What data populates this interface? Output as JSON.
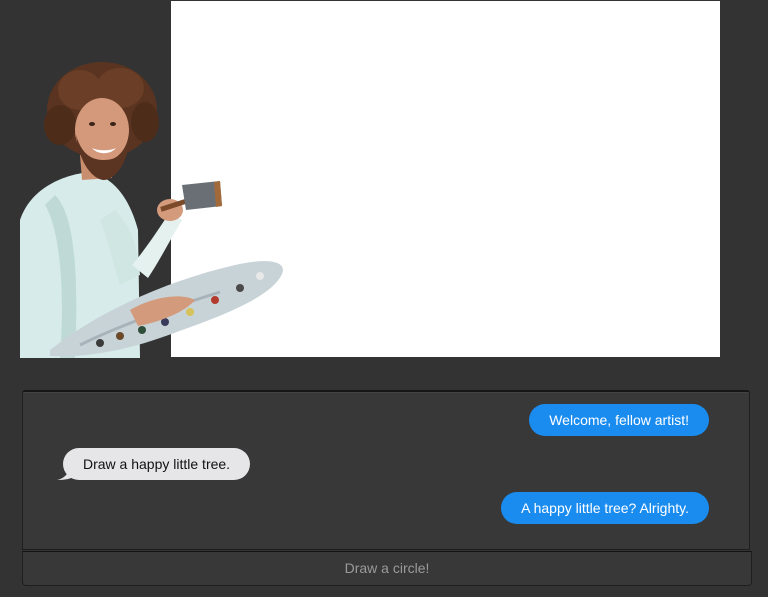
{
  "canvas": {
    "background": "#ffffff"
  },
  "painter": {
    "icon": "painter-with-palette-icon"
  },
  "chat": {
    "messages": [
      {
        "side": "outgoing",
        "text": "Welcome, fellow artist!"
      },
      {
        "side": "incoming",
        "text": "Draw a happy little tree."
      },
      {
        "side": "outgoing",
        "text": "A happy little tree? Alrighty."
      }
    ],
    "outgoing_color": "#1a8cf0",
    "incoming_color": "#e6e6e8"
  },
  "input": {
    "placeholder": "Draw a circle!"
  }
}
